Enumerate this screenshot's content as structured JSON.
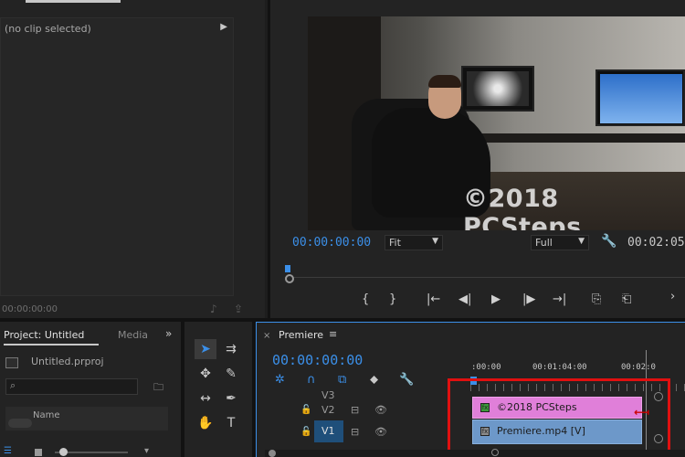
{
  "source_monitor": {
    "info_label": "(no clip selected)",
    "timecode": "00:00:00:00"
  },
  "program_monitor": {
    "watermark": "©2018 PCSteps",
    "timecode": "00:00:00:00",
    "zoom": "Fit",
    "resolution": "Full",
    "duration": "00:02:05:",
    "controls": [
      "{",
      "}",
      "|←",
      "◀|",
      "▶",
      "|▶",
      "→|",
      "⎘",
      "⎗"
    ]
  },
  "project": {
    "tab_label": "Project: Untitled",
    "media_tab": "Media",
    "file_name": "Untitled.prproj",
    "column_name": "Name"
  },
  "timeline": {
    "sequence_name": "Premiere",
    "timecode": "00:00:00:00",
    "ruler_labels": [
      ":00:00",
      "00:01:04:00",
      "00:02:0"
    ],
    "tracks": [
      {
        "name": "V3"
      },
      {
        "name": "V2"
      },
      {
        "name": "V1"
      }
    ],
    "clips": [
      {
        "label": "©2018 PCSteps",
        "badge": "fx",
        "color": "#e07fd9"
      },
      {
        "label": "Premiere.mp4 [V]",
        "badge": "fx",
        "color": "#6d98c9"
      }
    ]
  },
  "colors": {
    "accent": "#3b8fe8",
    "highlight_box": "#e01010"
  }
}
